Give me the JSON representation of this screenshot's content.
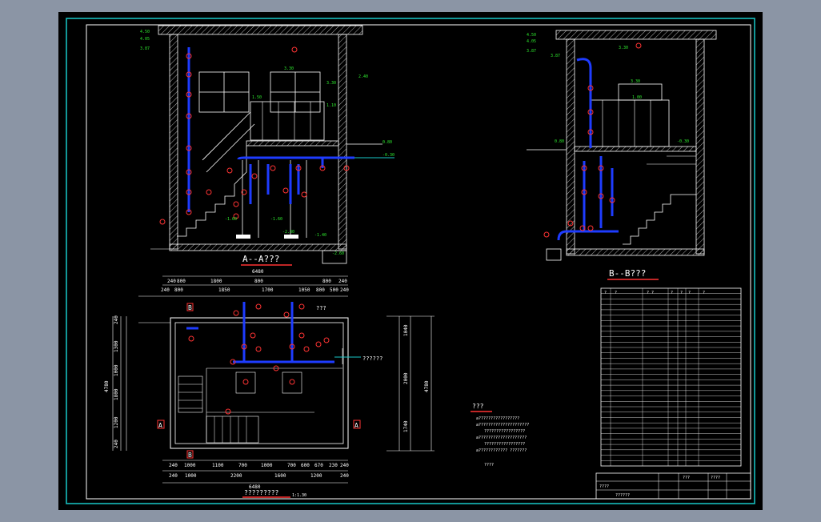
{
  "section_aa": {
    "label": "A--A???",
    "dims": [
      "4.50",
      "4.05",
      "3.87",
      "3.30",
      "3.30",
      "1.50",
      "1.10",
      "2.40",
      "0.80",
      "-0.30",
      "-1.60",
      "-1.60",
      "-2.30",
      "-1.40",
      "-2.60"
    ]
  },
  "section_bb": {
    "label": "B--B???",
    "dims": [
      "4.50",
      "4.05",
      "3.87",
      "3.30",
      "3.87",
      "3.30",
      "1.00",
      "0.80",
      "-0.30"
    ]
  },
  "plan": {
    "top_dims_1": [
      "240",
      "800",
      "1800",
      "800",
      "800",
      "240"
    ],
    "top_dims_2": [
      "240",
      "800",
      "1850",
      "1700",
      "1050",
      "800",
      "500",
      "240"
    ],
    "top_total": "6480",
    "bottom_dims_1": [
      "240",
      "1000",
      "1100",
      "700",
      "1000",
      "700",
      "600",
      "670",
      "230",
      "240"
    ],
    "bottom_dims_2": [
      "240",
      "1000",
      "2200",
      "1600",
      "1200",
      "240"
    ],
    "bottom_total": "6480",
    "left_dims": [
      "240",
      "1300",
      "1000",
      "1800",
      "1200",
      "240"
    ],
    "left_total": "4780",
    "right_dims": [
      "1040",
      "2000",
      "1740"
    ],
    "right_total": "4780",
    "marker_a": "A",
    "marker_b": "B",
    "label_q": "???",
    "label_pipe": "??????",
    "caption": "?????????",
    "scale": "1:1.30"
  },
  "notes": {
    "title": "???",
    "lines": [
      "a?????????????????",
      "a?????????????????????",
      "?????????????????",
      "a????????????????????",
      "?????????????????",
      "a???????????? ???????",
      "????"
    ]
  },
  "table": {
    "headers": [
      "?",
      "?",
      "? ?",
      "?",
      "?",
      "?",
      "?"
    ],
    "rows": 32
  },
  "title_block": {
    "cells": [
      "????",
      "??????",
      "???",
      "????"
    ]
  }
}
